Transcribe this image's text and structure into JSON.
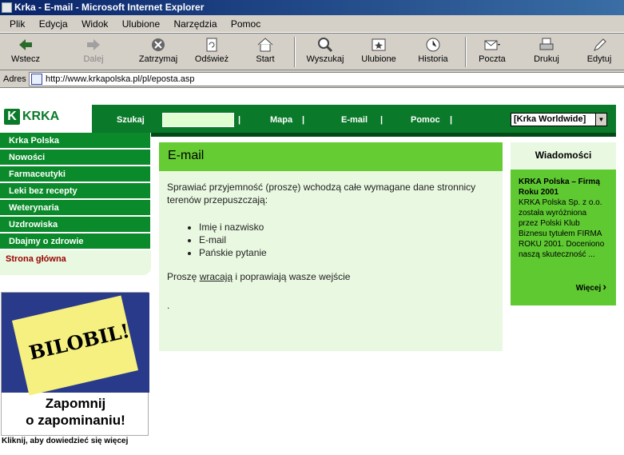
{
  "window": {
    "title": "Krka - E-mail - Microsoft Internet Explorer"
  },
  "menu": [
    "Plik",
    "Edycja",
    "Widok",
    "Ulubione",
    "Narzędzia",
    "Pomoc"
  ],
  "toolbar": [
    {
      "label": "Wstecz",
      "icon": "back-arrow-icon"
    },
    {
      "label": "Dalej",
      "icon": "forward-arrow-icon"
    },
    {
      "label": "Zatrzymaj",
      "icon": "stop-icon"
    },
    {
      "label": "Odśwież",
      "icon": "refresh-icon"
    },
    {
      "label": "Start",
      "icon": "home-icon"
    },
    {
      "label": "Wyszukaj",
      "icon": "search-icon"
    },
    {
      "label": "Ulubione",
      "icon": "favorites-icon"
    },
    {
      "label": "Historia",
      "icon": "history-icon"
    },
    {
      "label": "Poczta",
      "icon": "mail-icon"
    },
    {
      "label": "Drukuj",
      "icon": "print-icon"
    },
    {
      "label": "Edytuj",
      "icon": "edit-icon"
    }
  ],
  "address": {
    "label": "Adres",
    "url": "http://www.krkapolska.pl/pl/eposta.asp"
  },
  "site": {
    "logo": "KRKA",
    "nav": {
      "search_label": "Szukaj",
      "sep": "|",
      "map": "Mapa",
      "email": "E-mail",
      "help": "Pomoc",
      "select": "[Krka Worldwide]"
    },
    "sidebar": [
      "Krka Polska",
      "Nowości",
      "Farmaceutyki",
      "Leki bez recepty",
      "Weterynaria",
      "Uzdrowiska",
      "Dbajmy o zdrowie"
    ],
    "home": "Strona główna",
    "banner": {
      "note": "BILOBIL!",
      "line1": "Zapomnij",
      "line2": "o zapominaniu!",
      "caption": "Kliknij, aby dowiedzieć się więcej"
    },
    "content": {
      "title": "E-mail",
      "intro": "Sprawiać przyjemność (proszę) wchodzą całe wymagane dane stronnicy terenów przepuszczają:",
      "items": [
        "Imię i nazwisko",
        "E-mail",
        "Pańskie pytanie"
      ],
      "back_pre": "Proszę ",
      "back_link": "wracają",
      "back_post": " i poprawiają wasze wejście",
      "dot": "."
    },
    "news": {
      "title": "Wiadomości",
      "headline": "KRKA Polska – Firmą Roku 2001",
      "text": "KRKA Polska Sp. z o.o. została wyróżniona przez Polski Klub Biznesu tytułem FIRMA ROKU 2001. Doceniono naszą skuteczność ...",
      "more": "Więcej"
    }
  },
  "colors": {
    "dark_green": "#0a7a2a",
    "light_green": "#66cc33",
    "pale_green": "#e9f8e0",
    "title_blue": "#0a246a"
  }
}
